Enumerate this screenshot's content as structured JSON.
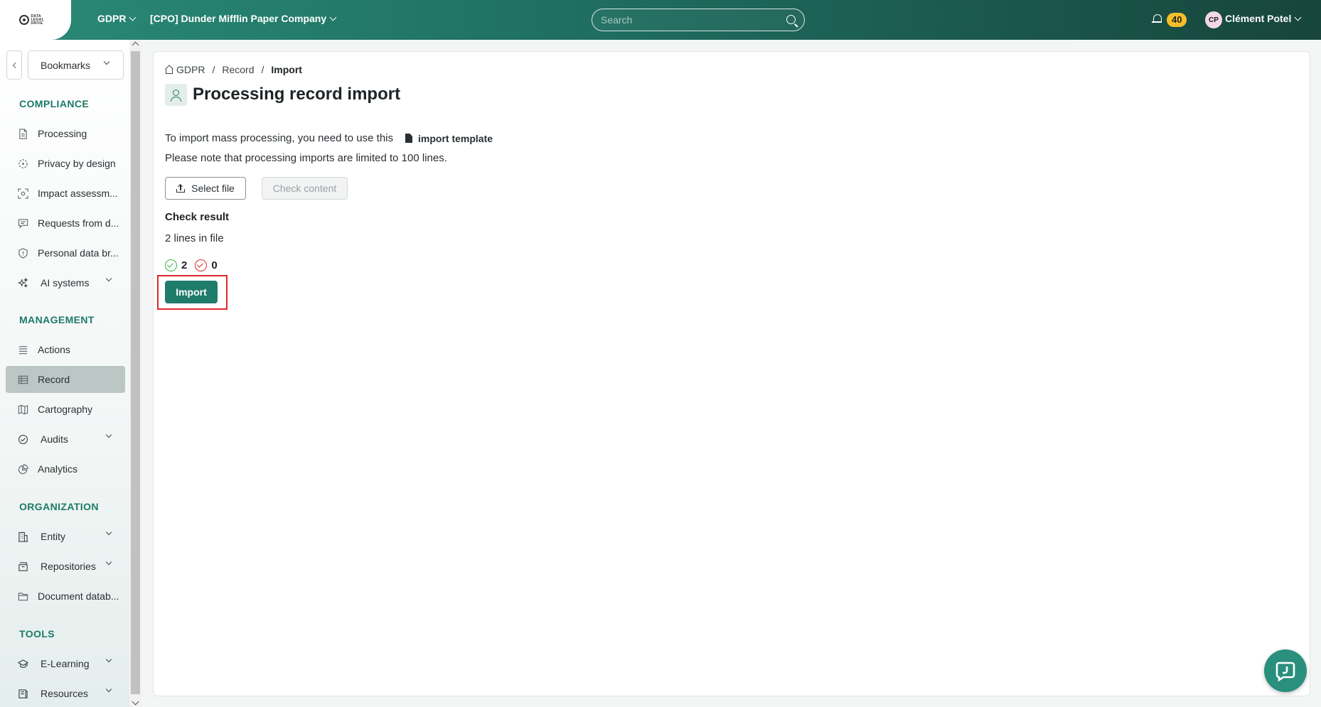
{
  "topbar": {
    "app_menu": "GDPR",
    "company_menu": "[CPO] Dunder Mifflin Paper Company",
    "search_placeholder": "Search",
    "notifications_count": "40",
    "user_initials": "CP",
    "user_name": "Clément Potel",
    "logo_text": "DATA LEGAL DRIVE"
  },
  "sidebar": {
    "bookmarks_label": "Bookmarks",
    "sections": {
      "compliance": "COMPLIANCE",
      "management": "MANAGEMENT",
      "organization": "ORGANIZATION",
      "tools": "TOOLS"
    },
    "items": {
      "processing": "Processing",
      "privacy_by_design": "Privacy by design",
      "impact_assessment": "Impact assessm...",
      "requests": "Requests from d...",
      "personal_data_breach": "Personal data br...",
      "ai_systems": "AI systems",
      "actions": "Actions",
      "record": "Record",
      "cartography": "Cartography",
      "audits": "Audits",
      "analytics": "Analytics",
      "entity": "Entity",
      "repositories": "Repositories",
      "document_database": "Document datab...",
      "elearning": "E-Learning",
      "resources": "Resources"
    }
  },
  "main": {
    "breadcrumb": [
      "GDPR",
      "Record",
      "Import"
    ],
    "page_title": "Processing record import",
    "intro_text": "To import mass processing, you need to use this",
    "template_link": "import template",
    "limit_text": "Please note that processing imports are limited to 100 lines.",
    "select_file_label": "Select file",
    "check_content_label": "Check content",
    "check_result_title": "Check result",
    "lines_in_file": "2 lines in file",
    "valid_count": "2",
    "error_count": "0",
    "import_label": "Import"
  },
  "colors": {
    "primary": "#1f7c6a",
    "accent_text": "#1c7a67",
    "badge": "#f6bf2a",
    "highlight_border": "#e0262c",
    "success": "#39b54a",
    "error": "#d42a2a"
  }
}
